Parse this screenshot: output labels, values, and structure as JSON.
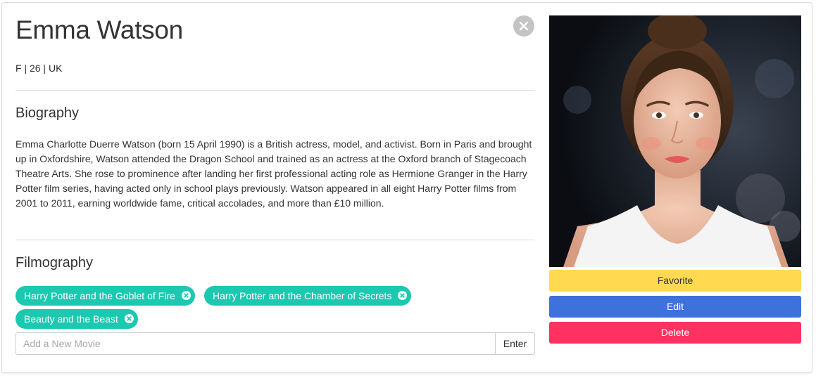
{
  "profile": {
    "name": "Emma Watson",
    "meta": "F | 26 | UK"
  },
  "biography": {
    "title": "Biography",
    "text": "Emma Charlotte Duerre Watson (born 15 April 1990) is a British actress, model, and activist. Born in Paris and brought up in Oxfordshire, Watson attended the Dragon School and trained as an actress at the Oxford branch of Stagecoach Theatre Arts. She rose to prominence after landing her first professional acting role as Hermione Granger in the Harry Potter film series, having acted only in school plays previously. Watson appeared in all eight Harry Potter films from 2001 to 2011, earning worldwide fame, critical accolades, and more than £10 million."
  },
  "filmography": {
    "title": "Filmography",
    "movies": [
      "Harry Potter and the Goblet of Fire",
      "Harry Potter and the Chamber of Secrets",
      "Beauty and the Beast"
    ],
    "input_placeholder": "Add a New Movie",
    "enter_label": "Enter"
  },
  "actions": {
    "favorite_label": "Favorite",
    "edit_label": "Edit",
    "delete_label": "Delete"
  },
  "icons": {
    "close": "close-icon",
    "remove_tag": "remove-tag-icon"
  },
  "colors": {
    "tag_bg": "#1cc9b0",
    "favorite": "#ffd94f",
    "edit": "#3d72dc",
    "delete": "#ff3160",
    "close_bg": "#c4c4c4"
  }
}
